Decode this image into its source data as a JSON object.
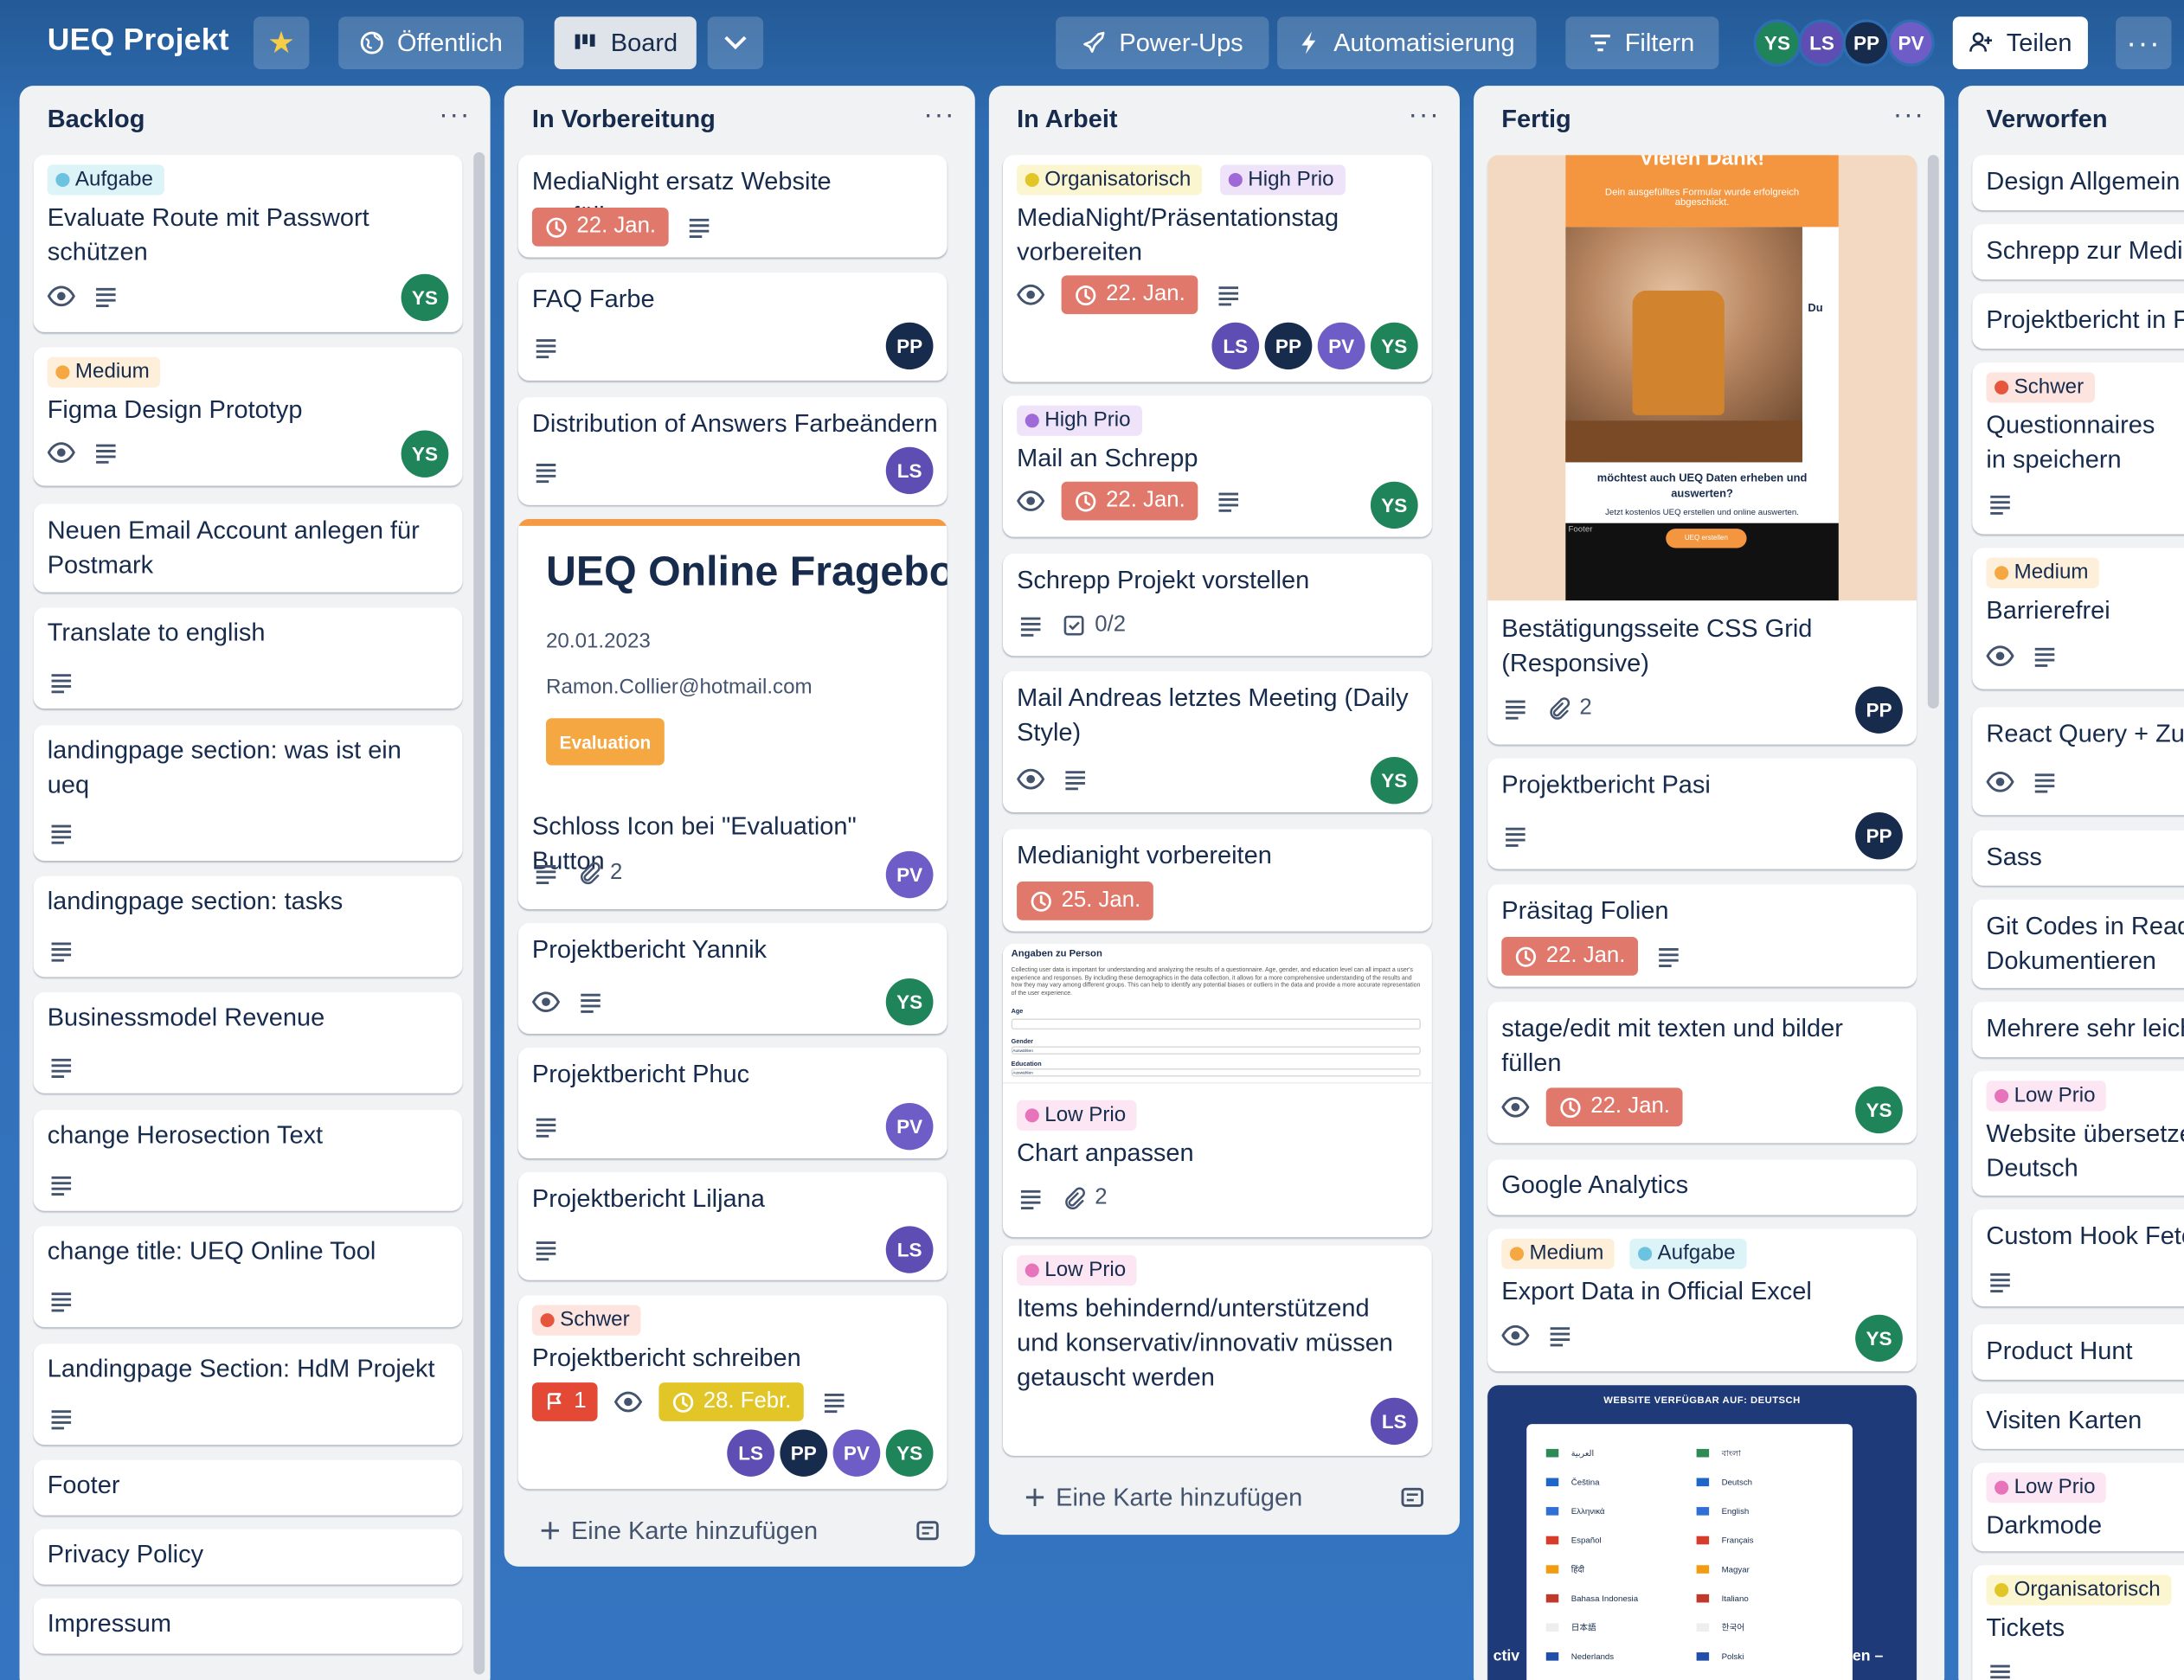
{
  "board": {
    "title": "UEQ Projekt",
    "visibility": "Öffentlich",
    "view": "Board",
    "powerups": "Power-Ups",
    "automation": "Automatisierung",
    "filter": "Filtern",
    "share": "Teilen",
    "members": [
      "YS",
      "LS",
      "PP",
      "PV"
    ]
  },
  "labels": {
    "aufgabe": {
      "text": "Aufgabe",
      "bg": "#dcf3f8",
      "dot": "#6cc3e0"
    },
    "medium": {
      "text": "Medium",
      "bg": "#fdefd9",
      "dot": "#f5a742"
    },
    "organisatorisch": {
      "text": "Organisatorisch",
      "bg": "#fbf5d0",
      "dot": "#e2c627"
    },
    "highprio": {
      "text": "High Prio",
      "bg": "#efe3fa",
      "dot": "#9f6ad8"
    },
    "lowprio": {
      "text": "Low Prio",
      "bg": "#fce6f3",
      "dot": "#e774bb"
    },
    "schwer": {
      "text": "Schwer",
      "bg": "#fde4df",
      "dot": "#e5563c"
    }
  },
  "add_card_label": "Eine Karte hinzufügen",
  "lists": {
    "backlog": {
      "title": "Backlog",
      "cards": [
        {
          "title": "Evaluate Route mit Passwort schützen",
          "label": "Aufgabe"
        },
        {
          "title": "Figma Design Prototyp",
          "label": "Medium"
        },
        {
          "title": "Neuen Email Account anlegen für Postmark"
        },
        {
          "title": "Translate to english"
        },
        {
          "title": "landingpage section: was ist ein ueq"
        },
        {
          "title": "landingpage section: tasks"
        },
        {
          "title": "Businessmodel Revenue"
        },
        {
          "title": "change Herosection Text"
        },
        {
          "title": "change title: UEQ Online Tool"
        },
        {
          "title": "Landingpage Section: HdM Projekt"
        },
        {
          "title": "Footer"
        },
        {
          "title": "Privacy Policy"
        },
        {
          "title": "Impressum"
        }
      ]
    },
    "prep": {
      "title": "In Vorbereitung",
      "cards": [
        {
          "title": "MediaNight ersatz Website ausfüllen",
          "due": "22. Jan."
        },
        {
          "title": "FAQ Farbe"
        },
        {
          "title": "Distribution of Answers Farbeändern"
        },
        {
          "title": "Schloss Icon bei \"Evaluation\" Button",
          "attachments": "2",
          "cover": {
            "heading": "UEQ Online Fragebogen",
            "date": "20.01.2023",
            "email": "Ramon.Collier@hotmail.com",
            "button": "Evaluation"
          }
        },
        {
          "title": "Projektbericht Yannik"
        },
        {
          "title": "Projektbericht Phuc"
        },
        {
          "title": "Projektbericht Liljana"
        },
        {
          "title": "Projektbericht schreiben",
          "label": "Schwer",
          "flag": "1",
          "due": "28. Febr."
        }
      ]
    },
    "work": {
      "title": "In Arbeit",
      "cards": [
        {
          "title": "MediaNight/Präsentationstag vorbereiten",
          "labels": [
            "Organisatorisch",
            "High Prio"
          ],
          "due": "22. Jan."
        },
        {
          "title": "Mail an Schrepp",
          "label": "High Prio",
          "due": "22. Jan."
        },
        {
          "title": "Schrepp Projekt vorstellen",
          "checklist": "0/2"
        },
        {
          "title": "Mail Andreas letztes Meeting (Daily Style)"
        },
        {
          "title": "Medianight vorbereiten",
          "due": "25. Jan."
        },
        {
          "title": "Chart anpassen",
          "label": "Low Prio",
          "attachments": "2",
          "cover": {
            "heading": "Angaben zu Person",
            "text": "Collecting user data is important for understanding and analyzing the results of a questionnaire. Age, gender, and education level can all impact a user's experience and responses. By including these demographics in the data collection, it allows for a more comprehensive understanding of the results and how they may vary among different groups. This can help to identify any potential biases or outliers in the data and provide a more accurate representation of the user experience.",
            "fields": [
              "Age",
              "Gender",
              "Education"
            ],
            "options": [
              "Auswählen",
              "Auswählen"
            ]
          }
        },
        {
          "title": "Items behindernd/unterstützend und konservativ/innovativ müssen getauscht werden",
          "label": "Low Prio"
        }
      ]
    },
    "done": {
      "title": "Fertig",
      "cards": [
        {
          "title": "Bestätigungsseite CSS Grid (Responsive)",
          "attachments": "2",
          "cover": {
            "heading": "Vielen Dank!",
            "sub": "Dein ausgefülltes Formular wurde erfolgreich abgeschickt.",
            "side": "Du",
            "question": "möchtest auch UEQ Daten erheben und auswerten?",
            "note": "Jetzt kostenlos UEQ erstellen und online auswerten.",
            "footer": "Footer",
            "button": "UEQ erstellen"
          }
        },
        {
          "title": "Projektbericht Pasi"
        },
        {
          "title": "Präsitag Folien",
          "due": "22. Jan."
        },
        {
          "title": "stage/edit mit texten und bilder füllen",
          "due": "22. Jan."
        },
        {
          "title": "Google Analytics"
        },
        {
          "title": "Export Data in Official Excel",
          "labels": [
            "Medium",
            "Aufgabe"
          ]
        },
        {
          "title": "",
          "cover": {
            "heading": "WEBSITE VERFÜGBAR AUF: DEUTSCH",
            "languages_left": [
              "العربية",
              "Čeština",
              "Ελληνικά",
              "Español",
              "हिंदी",
              "Bahasa Indonesia",
              "日本語",
              "Nederlands"
            ],
            "languages_right": [
              "বাংলা",
              "Deutsch",
              "English",
              "Français",
              "Magyar",
              "Italiano",
              "한국어",
              "Polski"
            ],
            "edge_left": "ctiv",
            "edge_right": "en –"
          }
        }
      ]
    },
    "discard": {
      "title": "Verworfen",
      "cards": [
        {
          "title": "Design Allgemein"
        },
        {
          "title": "Schrepp zur Medi"
        },
        {
          "title": "Projektbericht in F"
        },
        {
          "title": "Questionnaires in speichern",
          "label": "Schwer"
        },
        {
          "title": "Barrierefrei",
          "label": "Medium"
        },
        {
          "title": "React Query + Zu"
        },
        {
          "title": "Sass"
        },
        {
          "title": "Git Codes in Read Dokumentieren"
        },
        {
          "title": "Mehrere sehr leich"
        },
        {
          "title": "Website übersetze Deutsch",
          "label": "Low Prio"
        },
        {
          "title": "Custom Hook Fetc"
        },
        {
          "title": "Product Hunt"
        },
        {
          "title": "Visiten Karten"
        },
        {
          "title": "Darkmode",
          "label": "Low Prio"
        },
        {
          "title": "Tickets",
          "label": "Organisatorisch"
        }
      ]
    }
  }
}
